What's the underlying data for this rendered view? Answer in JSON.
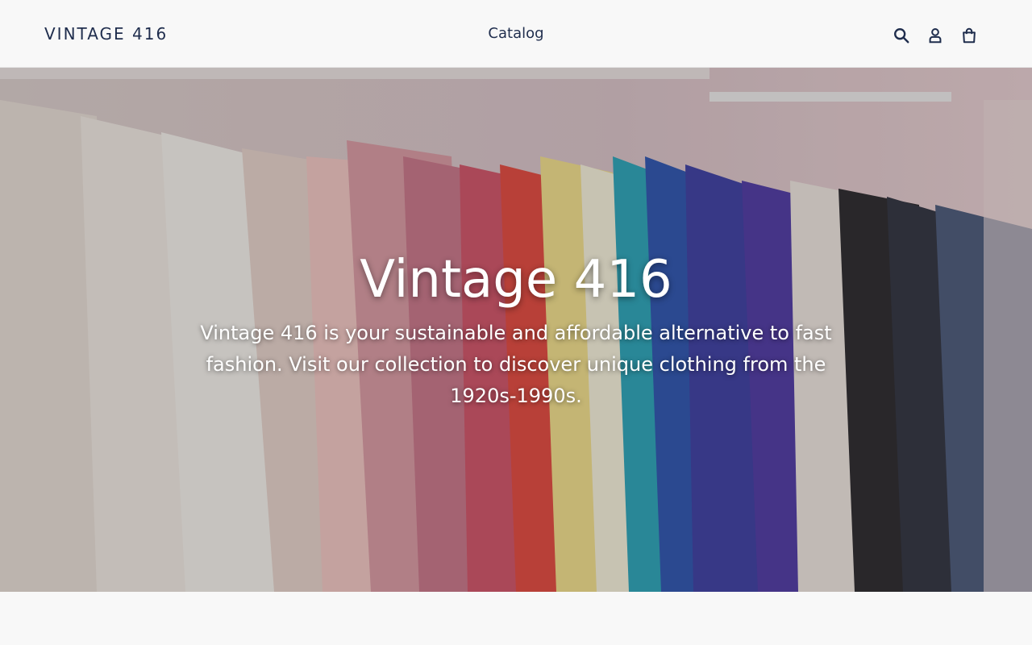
{
  "header": {
    "logo": "VINTAGE 416",
    "nav": [
      {
        "label": "Catalog"
      }
    ],
    "icons": [
      "search-icon",
      "account-icon",
      "cart-icon"
    ]
  },
  "hero": {
    "title": "Vintage 416",
    "subtitle": "Vintage 416 is your sustainable and affordable alternative to fast fashion. Visit our collection to discover unique clothing from the 1920s-1990s."
  },
  "colors": {
    "text_primary": "#1f2d4d",
    "background": "#f8f8f8",
    "hero_text": "#ffffff"
  }
}
